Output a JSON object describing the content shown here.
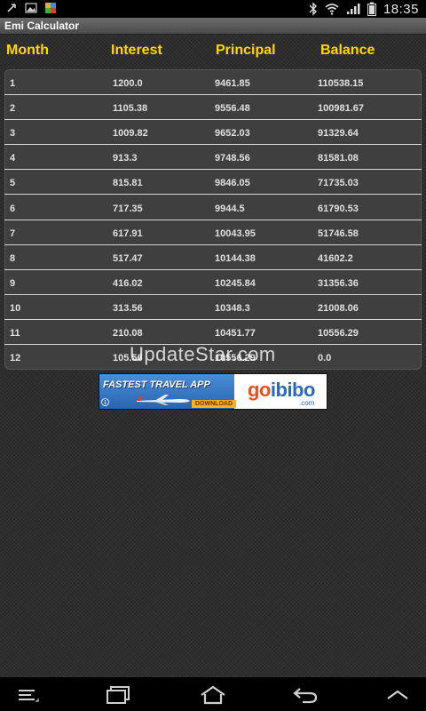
{
  "status_bar": {
    "time": "18:35"
  },
  "app": {
    "title": "Emi Calculator"
  },
  "columns": [
    "Month",
    "Interest",
    "Principal",
    "Balance"
  ],
  "rows": [
    [
      "1",
      "1200.0",
      "9461.85",
      "110538.15"
    ],
    [
      "2",
      "1105.38",
      "9556.48",
      "100981.67"
    ],
    [
      "3",
      "1009.82",
      "9652.03",
      "91329.64"
    ],
    [
      "4",
      "913.3",
      "9748.56",
      "81581.08"
    ],
    [
      "5",
      "815.81",
      "9846.05",
      "71735.03"
    ],
    [
      "6",
      "717.35",
      "9944.5",
      "61790.53"
    ],
    [
      "7",
      "617.91",
      "10043.95",
      "51746.58"
    ],
    [
      "8",
      "517.47",
      "10144.38",
      "41602.2"
    ],
    [
      "9",
      "416.02",
      "10245.84",
      "31356.36"
    ],
    [
      "10",
      "313.56",
      "10348.3",
      "21008.06"
    ],
    [
      "11",
      "210.08",
      "10451.77",
      "10556.29"
    ],
    [
      "12",
      "105.56",
      "10556.29",
      "0.0"
    ]
  ],
  "watermark": "UpdateStar.com",
  "ad": {
    "headline": "FASTEST TRAVEL APP",
    "cta": "DOWNLOAD NOW",
    "brand_part1": "go",
    "brand_part2": "ibibo",
    "domain": ".com"
  },
  "colors": {
    "header_yellow": "#ffd800",
    "status_bar": "#000000",
    "title_bar": "#5a5a5a",
    "table_bg": "#3f3f3f",
    "row_divider": "#d8d8d8"
  },
  "icons": {
    "status_left": [
      "usb-icon",
      "image-icon",
      "app-notification-icon"
    ],
    "status_right": [
      "bluetooth-icon",
      "wifi-icon",
      "signal-icon",
      "battery-icon"
    ],
    "nav": [
      "menu-icon",
      "recent-apps-icon",
      "home-icon",
      "back-icon",
      "chevron-up-icon"
    ]
  }
}
